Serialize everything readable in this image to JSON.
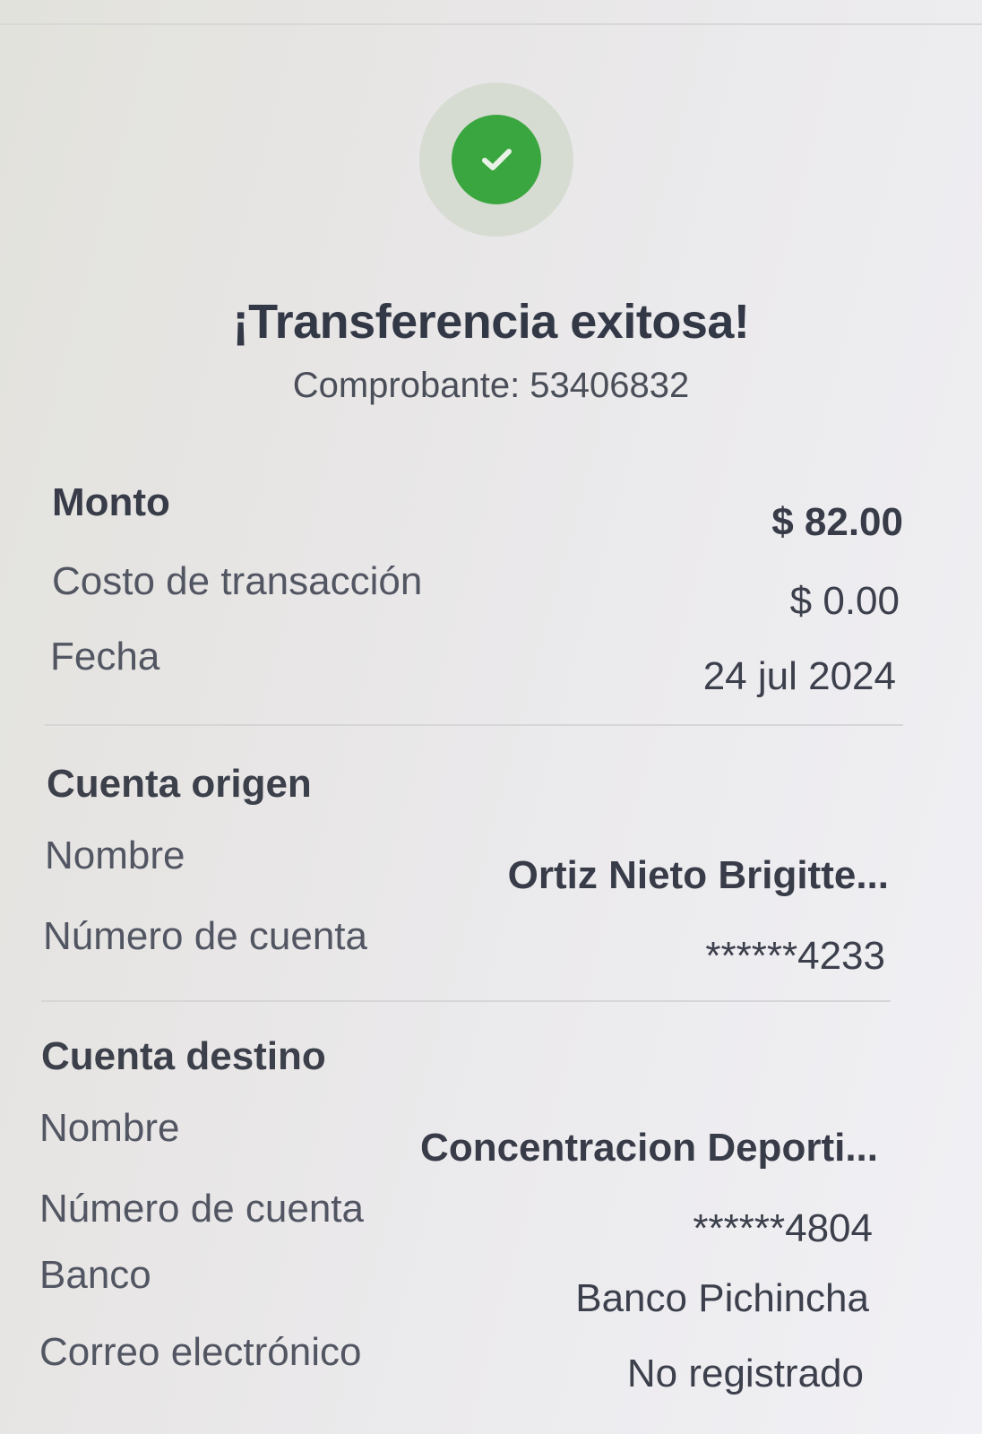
{
  "header": {
    "status_icon": "check-icon",
    "title": "¡Transferencia exitosa!",
    "receipt": "Comprobante: 53406832"
  },
  "summary": {
    "amount_label": "Monto",
    "amount_value": "$ 82.00",
    "fee_label": "Costo de transacción",
    "fee_value": "$ 0.00",
    "date_label": "Fecha",
    "date_value": "24 jul 2024"
  },
  "origin": {
    "section_title": "Cuenta origen",
    "name_label": "Nombre",
    "name_value": "Ortiz  Nieto Brigitte...",
    "account_label": "Número de cuenta",
    "account_value": "******4233"
  },
  "destination": {
    "section_title": "Cuenta destino",
    "name_label": "Nombre",
    "name_value": "Concentracion Deporti...",
    "account_label": "Número de cuenta",
    "account_value": "******4804",
    "bank_label": "Banco",
    "bank_value": "Banco Pichincha",
    "email_label": "Correo electrónico",
    "email_value": "No registrado"
  },
  "colors": {
    "success_green": "#3aa63f",
    "success_ring": "#d7dcd3",
    "text_dark": "#333846"
  }
}
